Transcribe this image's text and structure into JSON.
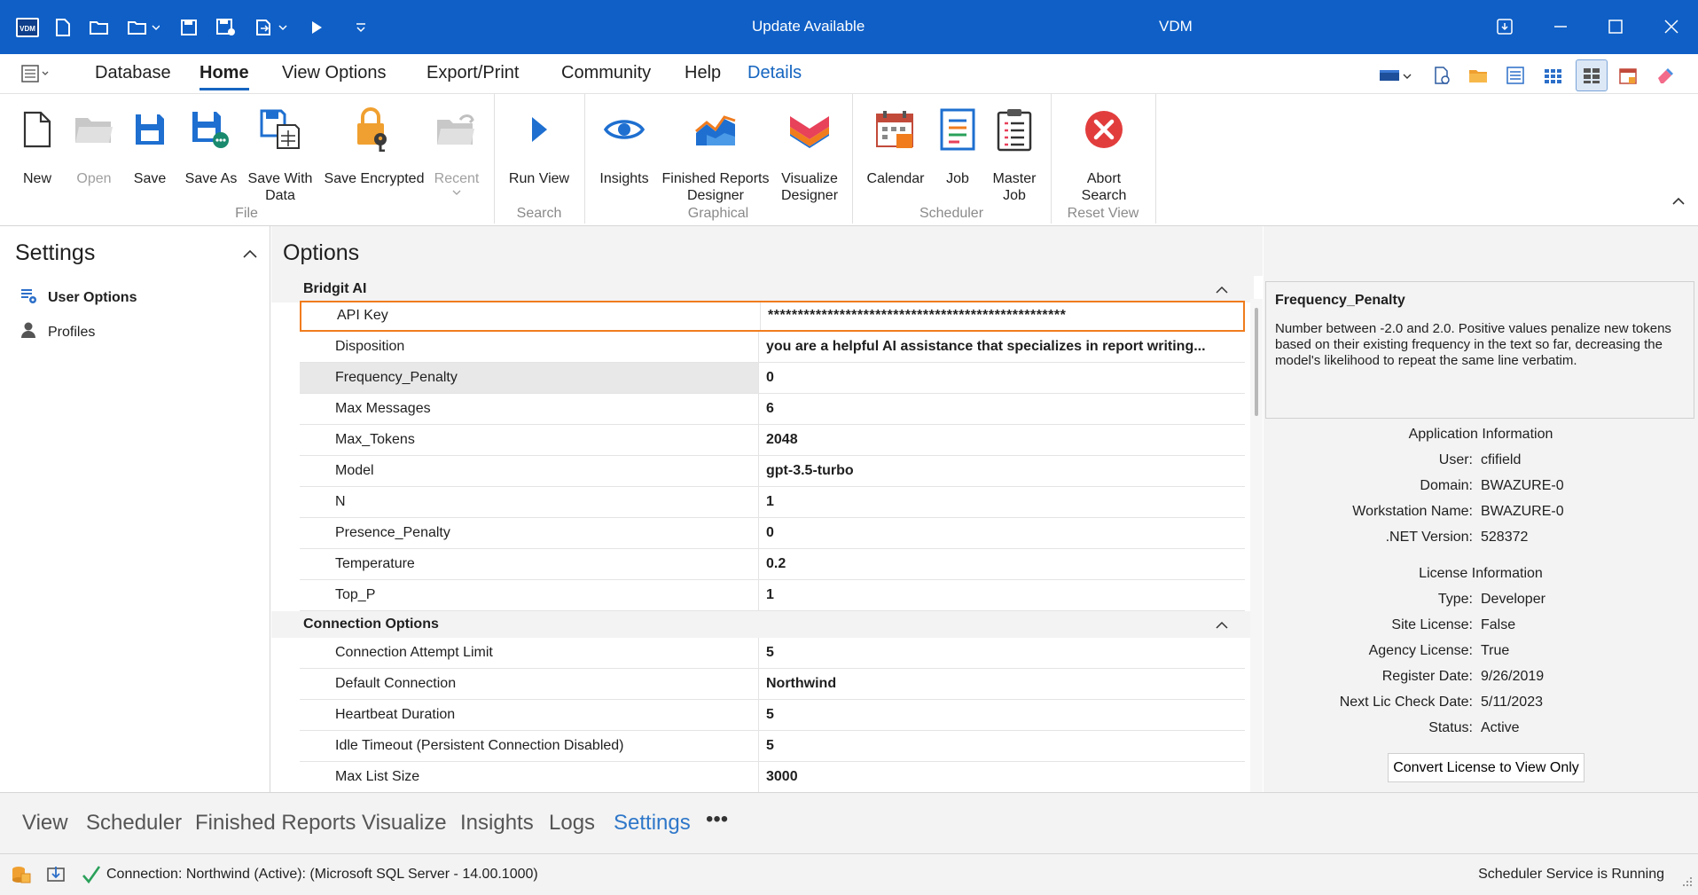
{
  "titlebar": {
    "update_text": "Update Available",
    "app_title": "VDM",
    "logo_text": "VDM"
  },
  "menu": {
    "tabs": [
      "Database",
      "Home",
      "View Options",
      "Export/Print",
      "Community",
      "Help",
      "Details"
    ],
    "active": "Home"
  },
  "ribbon": {
    "buttons": {
      "new": "New",
      "open": "Open",
      "save": "Save",
      "save_as": "Save As",
      "save_with_data": "Save With\nData",
      "save_encrypted": "Save Encrypted",
      "recent": "Recent",
      "run_view": "Run View",
      "insights": "Insights",
      "finished_reports_designer": "Finished Reports\nDesigner",
      "visualize_designer": "Visualize\nDesigner",
      "calendar": "Calendar",
      "job": "Job",
      "master_job": "Master\nJob",
      "abort_search": "Abort\nSearch"
    },
    "groups": {
      "file": "File",
      "search": "Search",
      "graphical": "Graphical",
      "scheduler": "Scheduler",
      "reset_view": "Reset View"
    }
  },
  "settings": {
    "title": "Settings",
    "items": [
      "User Options",
      "Profiles"
    ]
  },
  "options": {
    "title": "Options",
    "categories": [
      {
        "name": "Bridgit AI",
        "rows": [
          {
            "key": "API Key",
            "value": "**************************************************"
          },
          {
            "key": "Disposition",
            "value": "you are a helpful AI assistance that specializes in report writing..."
          },
          {
            "key": "Frequency_Penalty",
            "value": "0"
          },
          {
            "key": "Max Messages",
            "value": "6"
          },
          {
            "key": "Max_Tokens",
            "value": "2048"
          },
          {
            "key": "Model",
            "value": "gpt-3.5-turbo"
          },
          {
            "key": "N",
            "value": "1"
          },
          {
            "key": "Presence_Penalty",
            "value": "0"
          },
          {
            "key": "Temperature",
            "value": "0.2"
          },
          {
            "key": "Top_P",
            "value": "1"
          }
        ]
      },
      {
        "name": "Connection Options",
        "rows": [
          {
            "key": "Connection Attempt Limit",
            "value": "5"
          },
          {
            "key": "Default Connection",
            "value": "Northwind"
          },
          {
            "key": "Heartbeat Duration",
            "value": "5"
          },
          {
            "key": "Idle Timeout (Persistent Connection Disabled)",
            "value": "5"
          },
          {
            "key": "Max List Size",
            "value": "3000"
          }
        ]
      }
    ]
  },
  "description": {
    "title": "Frequency_Penalty",
    "text": "Number between -2.0 and 2.0. Positive values penalize new tokens based on their existing frequency in the text so far, decreasing the model's likelihood to repeat the same line verbatim."
  },
  "app_info": {
    "heading": "Application Information",
    "items": [
      {
        "label": "User:",
        "value": "cfifield"
      },
      {
        "label": "Domain:",
        "value": "BWAZURE-0"
      },
      {
        "label": "Workstation Name:",
        "value": "BWAZURE-0"
      },
      {
        "label": ".NET Version:",
        "value": "528372"
      }
    ]
  },
  "license_info": {
    "heading": "License Information",
    "items": [
      {
        "label": "Type:",
        "value": "Developer"
      },
      {
        "label": "Site License:",
        "value": "False"
      },
      {
        "label": "Agency License:",
        "value": "True"
      },
      {
        "label": "Register Date:",
        "value": "9/26/2019"
      },
      {
        "label": "Next Lic Check Date:",
        "value": "5/11/2023"
      },
      {
        "label": "Status:",
        "value": "Active"
      }
    ],
    "convert_button": "Convert License to View Only"
  },
  "bottom_nav": {
    "items": [
      "View",
      "Scheduler",
      "Finished Reports",
      "Visualize",
      "Insights",
      "Logs",
      "Settings"
    ],
    "active": "Settings",
    "more": "•••"
  },
  "status": {
    "connection": "Connection: Northwind (Active): (Microsoft SQL Server - 14.00.1000)",
    "scheduler": "Scheduler Service is Running"
  },
  "colors": {
    "titlebar": "#0f5fc6",
    "accent": "#1565c0",
    "highlight_border": "#f07c1e"
  }
}
